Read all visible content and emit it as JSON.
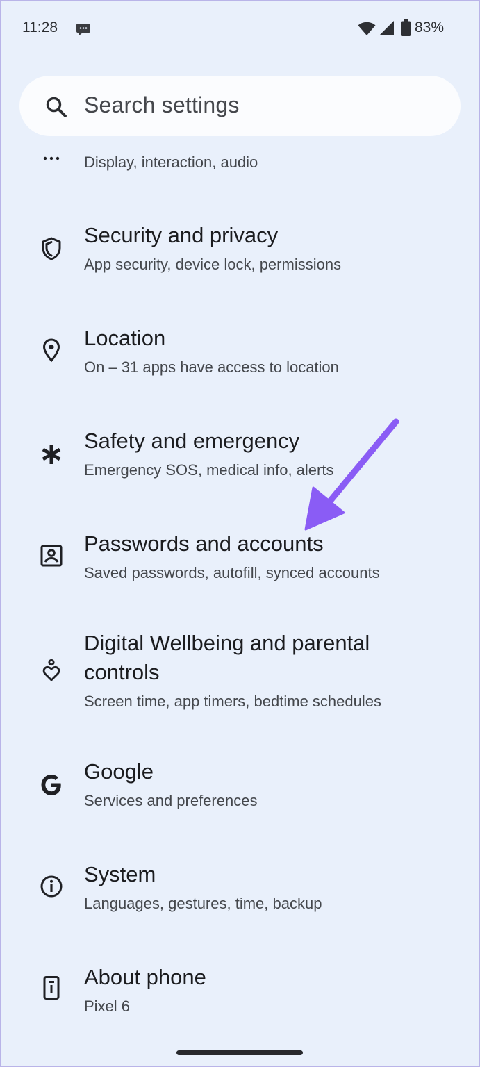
{
  "status_bar": {
    "time": "11:28",
    "battery": "83%",
    "icons": [
      "chat-bubble-icon",
      "wifi-icon",
      "signal-icon",
      "battery-icon"
    ]
  },
  "search": {
    "label": "Search settings",
    "icon": "search-icon"
  },
  "settings": {
    "items": [
      {
        "title": "",
        "subtitle": "Display, interaction, audio",
        "icon": "more-horiz-icon"
      },
      {
        "title": "Security and privacy",
        "subtitle": "App security, device lock, permissions",
        "icon": "shield-icon"
      },
      {
        "title": "Location",
        "subtitle": "On – 31 apps have access to location",
        "icon": "location-pin-icon"
      },
      {
        "title": "Safety and emergency",
        "subtitle": "Emergency SOS, medical info, alerts",
        "icon": "asterisk-icon"
      },
      {
        "title": "Passwords and accounts",
        "subtitle": "Saved passwords, autofill, synced accounts",
        "icon": "account-box-icon"
      },
      {
        "title": "Digital Wellbeing and parental controls",
        "subtitle": "Screen time, app timers, bedtime schedules",
        "icon": "wellbeing-icon"
      },
      {
        "title": "Google",
        "subtitle": "Services and preferences",
        "icon": "google-g-icon"
      },
      {
        "title": "System",
        "subtitle": "Languages, gestures, time, backup",
        "icon": "info-icon"
      },
      {
        "title": "About phone",
        "subtitle": "Pixel 6",
        "icon": "phone-icon"
      }
    ]
  },
  "annotation": {
    "arrow_color": "#8a5cf5",
    "target": "Passwords and accounts"
  },
  "colors": {
    "background": "#e9f0fb",
    "search_bg": "#fbfcfe",
    "title_text": "#1b1c1f",
    "subtitle_text": "#44474c"
  }
}
